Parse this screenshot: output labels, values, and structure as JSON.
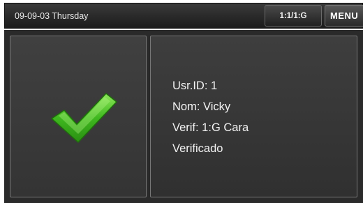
{
  "status_bar": {
    "datetime": "09-09-03 Thursday",
    "mode_button": "1:1/1:G",
    "menu_button": "MENU"
  },
  "result": {
    "icon": "checkmark-icon",
    "icon_color": "#3fb81f",
    "lines": [
      "Usr.ID: 1",
      "Nom: Vicky",
      "Verif: 1:G Cara",
      "Verificado"
    ]
  }
}
